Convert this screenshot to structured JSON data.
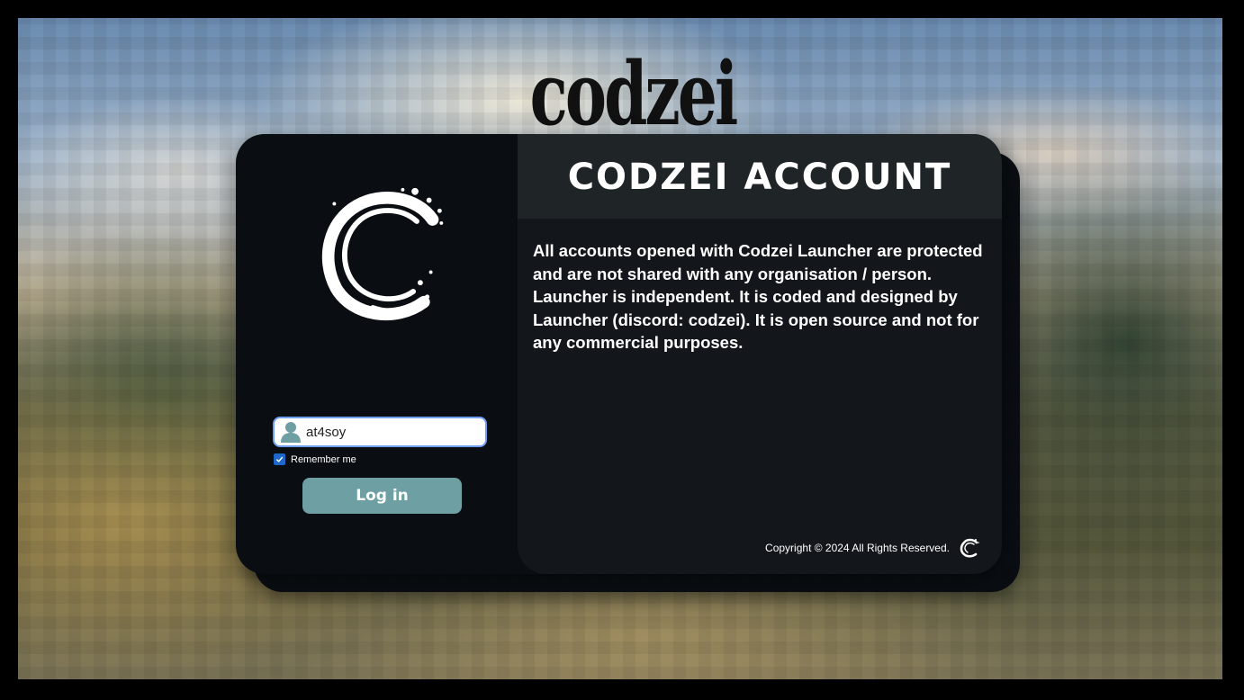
{
  "brand": {
    "wordmark": "codzei"
  },
  "info": {
    "title": "CODZEI ACCOUNT",
    "body": "All accounts opened with Codzei Launcher are protected and are not shared with any organisation / person. Launcher is independent. It is coded and designed by Launcher (discord: codzei). It is open source and not for any commercial purposes.",
    "copyright": "Copyright © 2024 All Rights Reserved."
  },
  "login": {
    "username_value": "at4soy",
    "remember_label": "Remember me",
    "remember_checked": true,
    "button_label": "Log in"
  },
  "colors": {
    "button": "#6e9fa2",
    "card": "#0a0e13",
    "panel": "#13171b",
    "header": "#1f2427",
    "checkbox": "#1d68c9"
  },
  "icons": {
    "logo": "swirl-c-logo-icon",
    "user": "user-icon",
    "check": "check-icon"
  }
}
